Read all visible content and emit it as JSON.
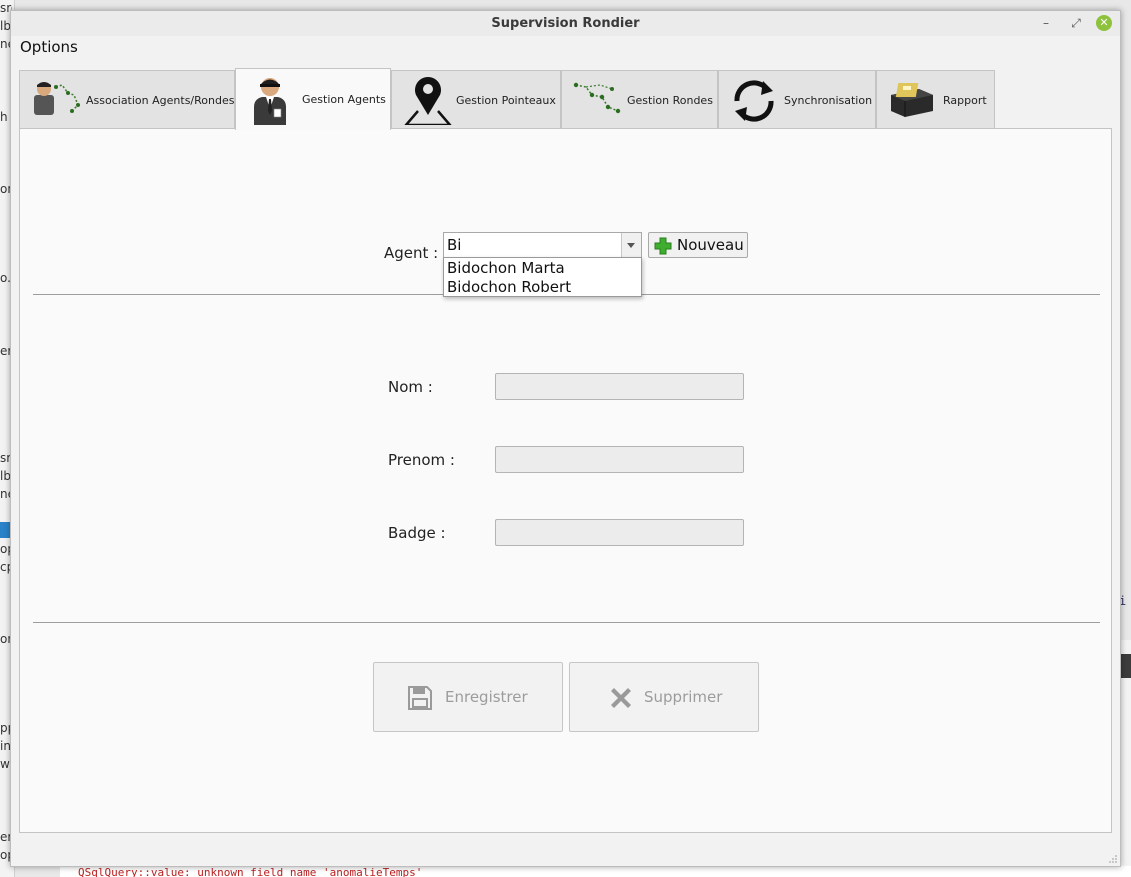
{
  "window": {
    "title": "Supervision Rondier"
  },
  "menu": {
    "options": "Options"
  },
  "tabs": [
    {
      "label": "Association Agents/Rondes",
      "icon": "agent-route-icon"
    },
    {
      "label": "Gestion Agents",
      "icon": "agent-icon",
      "active": true
    },
    {
      "label": "Gestion Pointeaux",
      "icon": "map-pin-icon"
    },
    {
      "label": "Gestion Rondes",
      "icon": "route-icon"
    },
    {
      "label": "Synchronisation",
      "icon": "sync-icon"
    },
    {
      "label": "Rapport",
      "icon": "report-box-icon"
    }
  ],
  "agent": {
    "label": "Agent :",
    "combo_value": "Bi",
    "new_button": "Nouveau",
    "suggestions": [
      "Bidochon Marta",
      "Bidochon Robert"
    ]
  },
  "form": {
    "nom_label": "Nom :",
    "prenom_label": "Prenom :",
    "badge_label": "Badge :",
    "nom_value": "",
    "prenom_value": "",
    "badge_value": ""
  },
  "actions": {
    "save": "Enregistrer",
    "delete": "Supprimer"
  },
  "background": {
    "left_fragments": [
      "srondes.h",
      "lb",
      "ne",
      "h",
      "on",
      "o.l",
      "er.",
      "sr",
      "lb",
      "ne",
      "op",
      "cp",
      "on",
      "pp",
      "in",
      "wi",
      "er.",
      "op"
    ],
    "right_fragment": "i",
    "bottom_text": "QSqlQuery::value: unknown field name 'anomalieTemps'"
  }
}
